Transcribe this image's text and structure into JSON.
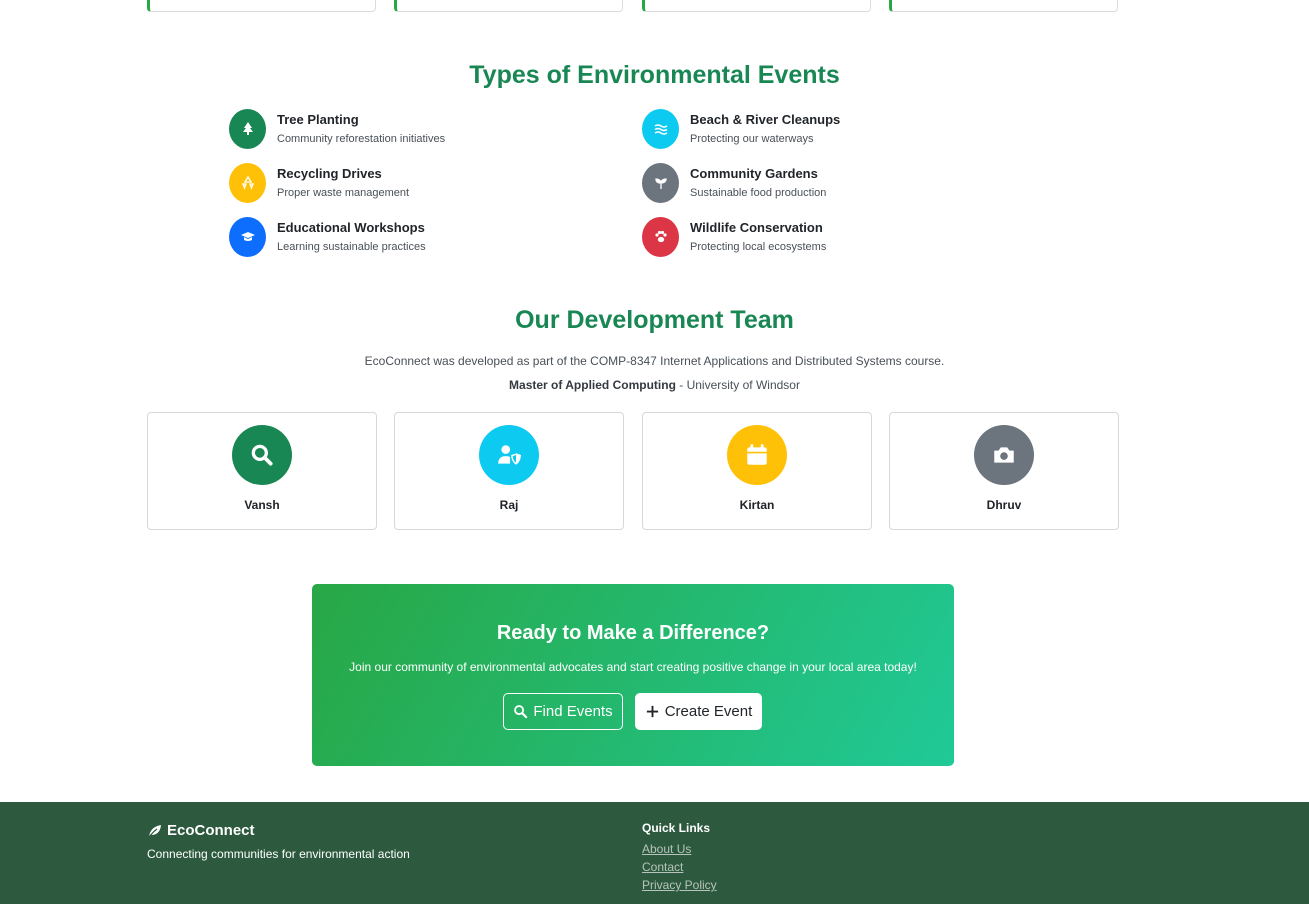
{
  "events_section": {
    "title": "Types of Environmental Events",
    "items": [
      {
        "title": "Tree Planting",
        "desc": "Community reforestation initiatives",
        "icon": "tree-icon",
        "color": "#198754"
      },
      {
        "title": "Beach & River Cleanups",
        "desc": "Protecting our waterways",
        "icon": "water-icon",
        "color": "#0dcaf0"
      },
      {
        "title": "Recycling Drives",
        "desc": "Proper waste management",
        "icon": "recycle-icon",
        "color": "#ffc107"
      },
      {
        "title": "Community Gardens",
        "desc": "Sustainable food production",
        "icon": "seedling-icon",
        "color": "#6c757d"
      },
      {
        "title": "Educational Workshops",
        "desc": "Learning sustainable practices",
        "icon": "graduation-cap-icon",
        "color": "#0d6efd"
      },
      {
        "title": "Wildlife Conservation",
        "desc": "Protecting local ecosystems",
        "icon": "paw-icon",
        "color": "#dc3545"
      }
    ]
  },
  "team_section": {
    "title": "Our Development Team",
    "course_text": "EcoConnect was developed as part of the COMP-8347 Internet Applications and Distributed Systems course.",
    "program": "Master of Applied Computing",
    "separator": " - ",
    "university": "University of Windsor",
    "members": [
      {
        "name": "Vansh",
        "icon": "search-icon",
        "color": "#198754"
      },
      {
        "name": "Raj",
        "icon": "user-shield-icon",
        "color": "#0dcaf0"
      },
      {
        "name": "Kirtan",
        "icon": "calendar-icon",
        "color": "#ffc107"
      },
      {
        "name": "Dhruv",
        "icon": "camera-icon",
        "color": "#6c757d"
      }
    ]
  },
  "cta": {
    "title": "Ready to Make a Difference?",
    "subtitle": "Join our community of environmental advocates and start creating positive change in your local area today!",
    "find_label": "Find Events",
    "create_label": "Create Event"
  },
  "footer": {
    "brand": "EcoConnect",
    "tagline": "Connecting communities for environmental action",
    "quick_links_title": "Quick Links",
    "links": [
      "About Us",
      "Contact",
      "Privacy Policy"
    ],
    "background": "#2d5a3e"
  }
}
